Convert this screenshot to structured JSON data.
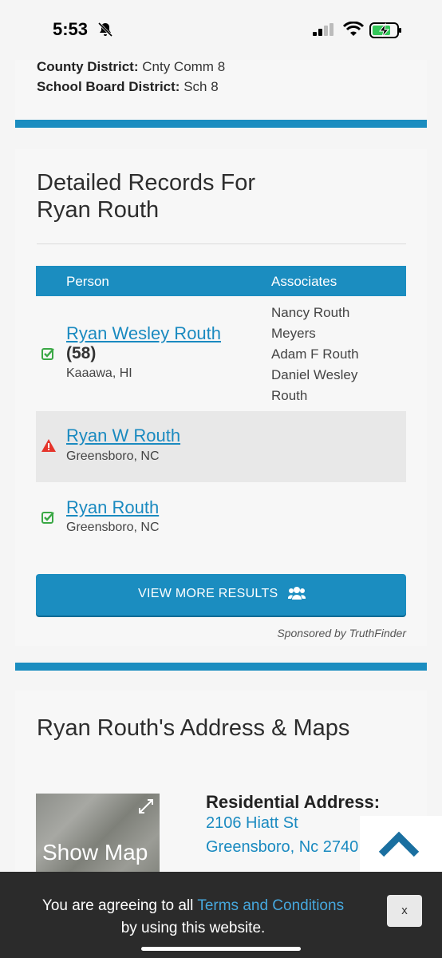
{
  "status_bar": {
    "time": "5:53"
  },
  "district": {
    "county_label": "County District:",
    "county_value": "Cnty Comm 8",
    "school_label": "School Board District:",
    "school_value": "Sch 8"
  },
  "records": {
    "title_line1": "Detailed Records For",
    "title_line2": "Ryan Routh",
    "col_person": "Person",
    "col_associates": "Associates",
    "rows": [
      {
        "name": "Ryan Wesley Routh",
        "age": "(58)",
        "location": "Kaaawa, HI",
        "status": "verified",
        "associates": [
          "Nancy Routh",
          "Meyers",
          "Adam F Routh",
          "Daniel Wesley",
          "Routh"
        ]
      },
      {
        "name": "Ryan W Routh",
        "location": "Greensboro, NC",
        "status": "warning"
      },
      {
        "name": "Ryan Routh",
        "location": "Greensboro, NC",
        "status": "verified"
      }
    ],
    "button_label": "VIEW MORE RESULTS",
    "sponsor": "Sponsored by TruthFinder"
  },
  "address": {
    "title": "Ryan Routh's Address & Maps",
    "map_label": "Show Map",
    "heading": "Residential Address:",
    "line1": "2106 Hiatt St",
    "line2": "Greensboro, Nc 2740"
  },
  "consent": {
    "prefix": "You are agreeing to all ",
    "link": "Terms and Conditions",
    "suffix": "by using this website.",
    "close": "x"
  },
  "icons": {
    "verified": "check-square-icon",
    "warning": "warning-triangle-icon",
    "group": "users-icon",
    "expand": "expand-icon",
    "back_to_top": "chevron-up-icon"
  },
  "colors": {
    "brand_blue": "#1b8dc0",
    "link_blue": "#1a8ac0",
    "check_green": "#3aa845",
    "warn_red": "#e5342b"
  }
}
